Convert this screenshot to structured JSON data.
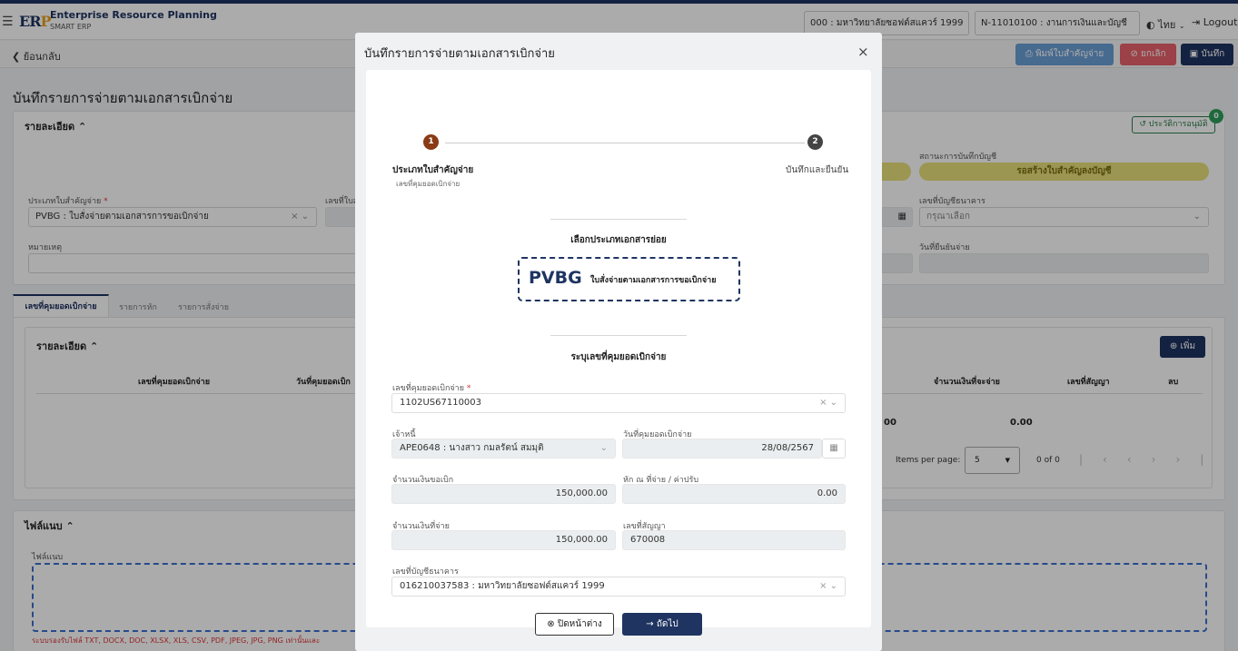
{
  "header": {
    "app_title": "Enterprise Resource Planning",
    "app_sub": "SMART ERP",
    "org": "000 : มหาวิทยาลัยซอฟต์สแควร์ 1999",
    "dept": "N-11010100 : งานการเงินและบัญชี",
    "lang": "ไทย",
    "logout": "Logout"
  },
  "subbar": {
    "back": "ย้อนกลับ",
    "print": "พิมพ์ใบสำคัญจ่าย",
    "cancel": "ยกเลิก",
    "save": "บันทึก"
  },
  "page": {
    "title": "บันทึกรายการจ่ายตามเอกสารเบิกจ่าย",
    "detail_title": "รายละเอียด",
    "history": "ประวัติการอนุมัติ",
    "history_count": "0",
    "record_status_label": "สถานะการบันทึกบัญชี",
    "record_status": "รอสร้างใบสำคัญลงบัญชี",
    "voucher_type_label": "ประเภทใบสำคัญจ่าย",
    "voucher_type": "PVBG : ใบสั่งจ่ายตามเอกสารการขอเบิกจ่าย",
    "voucher_no_label": "เลขที่ใบส",
    "bank_label": "เลขที่บัญชีธนาคาร",
    "bank_placeholder": "กรุณาเลือก",
    "note_label": "หมายเหตุ",
    "confirm_date_label": "วันที่ยืนยันจ่าย",
    "tabs": [
      "เลขที่คุมยอดเบิกจ่าย",
      "รายการหัก",
      "รายการสั่งจ่าย"
    ],
    "inner_title": "รายละเอียด",
    "add": "เพิ่ม",
    "col_control": "เลขที่คุมยอดเบิกจ่าย",
    "col_date": "วันที่คุมยอดเบิก",
    "col_paying": "จำนวนเงินที่จะจ่าย",
    "col_contract": "เลขที่สัญญา",
    "col_delete": "ลบ",
    "total_a": "00",
    "total_b": "0.00",
    "items_per_page": "Items per page:",
    "per_page_value": "5",
    "range": "0 of 0",
    "attach_title": "ไฟล์แนบ",
    "attach_label": "ไฟล์แนบ",
    "attach_hint": "ระบบรองรับไฟล์ TXT, DOCX, DOC, XLSX, XLS, CSV, PDF, JPEG, JPG, PNG เท่านั้นและ"
  },
  "modal": {
    "title": "บันทึกรายการจ่ายตามเอกสารเบิกจ่าย",
    "step1_num": "1",
    "step1_title": "ประเภทใบสำคัญจ่าย",
    "step1_sub": "เลขที่คุมยอดเบิกจ่าย",
    "step2_num": "2",
    "step2_title": "บันทึกและยืนยัน",
    "section1": "เลือกประเภทเอกสารย่อย",
    "pv_code": "PVBG",
    "pv_text": "ใบสั่งจ่ายตามเอกสารการขอเบิกจ่าย",
    "section2": "ระบุเลขที่คุมยอดเบิกจ่าย",
    "control_label": "เลขที่คุมยอดเบิกจ่าย",
    "control_value": "1102US67110003",
    "creditor_label": "เจ้าหนี้",
    "creditor_value": "APE0648 : นางสาว กมลรัตน์ สมมุติ",
    "date_label": "วันที่คุมยอดเบิกจ่าย",
    "date_value": "28/08/2567",
    "request_label": "จำนวนเงินขอเบิก",
    "request_value": "150,000.00",
    "deduct_label": "หัก ณ ที่จ่าย / ค่าปรับ",
    "deduct_value": "0.00",
    "pay_label": "จำนวนเงินที่จ่าย",
    "pay_value": "150,000.00",
    "contract_label": "เลขที่สัญญา",
    "contract_value": "670008",
    "bank_label": "เลขที่บัญชีธนาคาร",
    "bank_value": "016210037583 : มหาวิทยาลัยซอฟต์สแควร์ 1999",
    "close": "ปิดหน้าต่าง",
    "next": "ถัดไป"
  },
  "colors": {
    "navy": "#1f3461",
    "yellow": "#e8e07a",
    "red": "#e8626b",
    "blue": "#6a9ed6",
    "step1": "#8a3b16",
    "step2": "#444444"
  }
}
